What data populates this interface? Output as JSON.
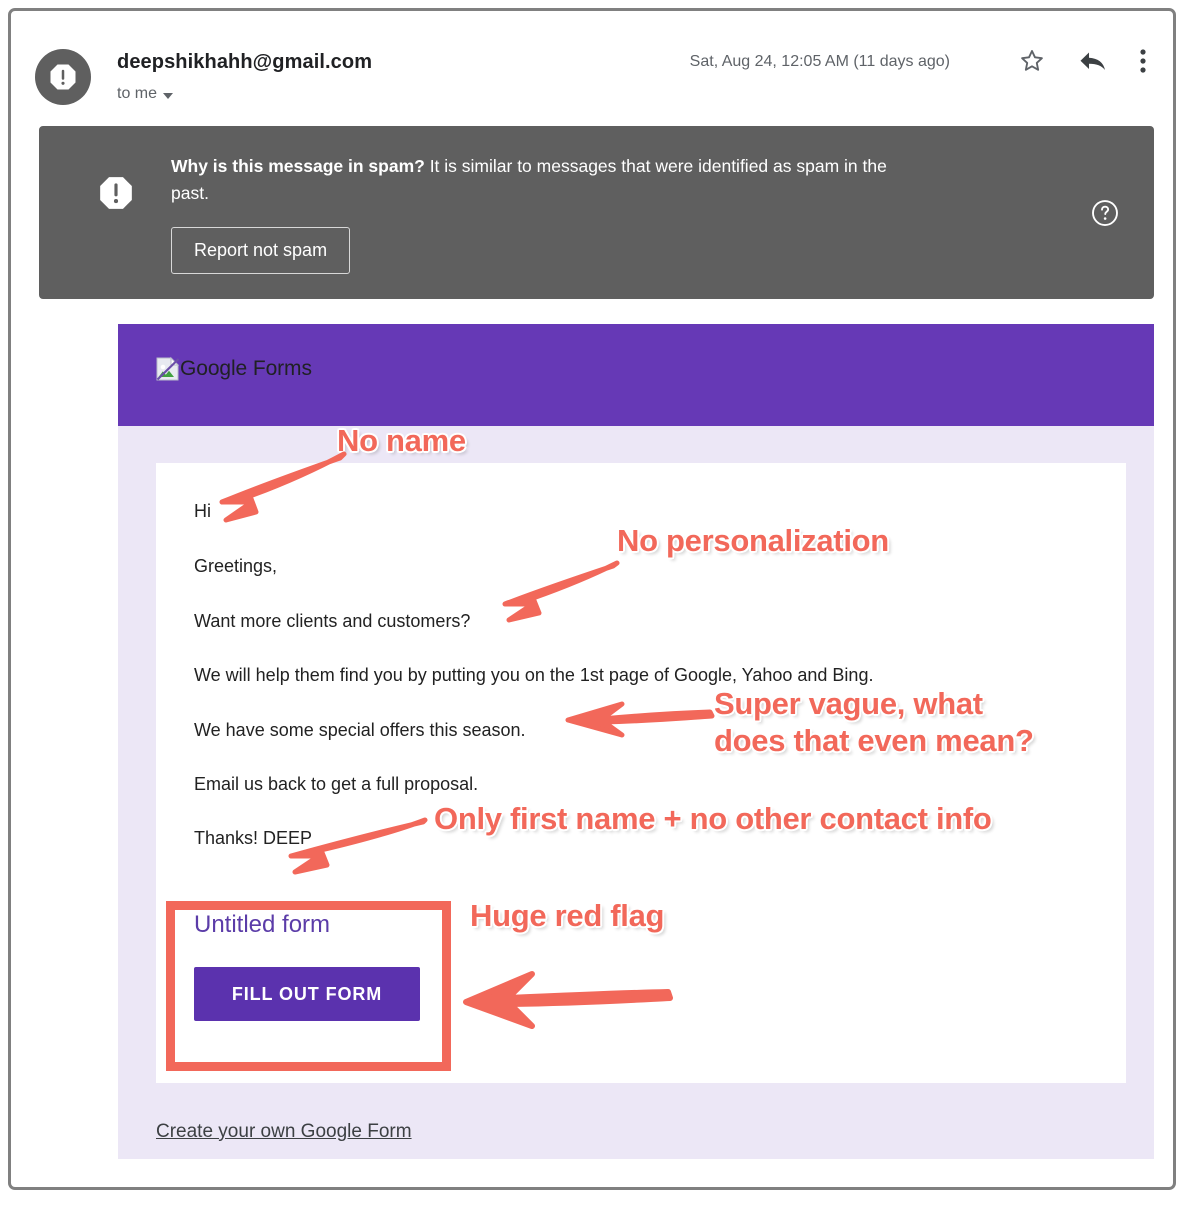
{
  "header": {
    "sender_email": "deepshikhahh@gmail.com",
    "recipient_label": "to me",
    "date": "Sat, Aug 24, 12:05 AM (11 days ago)",
    "avatar_icon": "spam-octagon-icon",
    "star_icon": "star-outline-icon",
    "reply_icon": "reply-arrow-icon",
    "more_icon": "kebab-menu-icon",
    "caret_icon": "chevron-down-icon"
  },
  "spam_banner": {
    "icon": "spam-octagon-icon",
    "question": "Why is this message in spam?",
    "explanation": " It is similar to messages that were identified as spam in the past.",
    "report_button": "Report not spam",
    "help_icon": "help-circle-icon",
    "background": "#5f5f5f"
  },
  "email": {
    "hero": {
      "background": "#6639b6",
      "image_alt": "Google Forms",
      "image_icon": "broken-image-icon"
    },
    "body_lines": [
      "Hi",
      "Greetings,",
      "Want more clients and customers?",
      "We will help them find you by putting you on the 1st page of Google, Yahoo and Bing.",
      "We have some special offers this season.",
      "Email us back to get a full proposal."
    ],
    "signature": "Thanks!\nDEEP",
    "form_card": {
      "title": "Untitled form",
      "button_label": "FILL OUT FORM",
      "button_color": "#5b32ae",
      "title_color": "#5b3ca8"
    },
    "footer_link": "Create your own Google Form",
    "background": "#ece7f6"
  },
  "annotations": {
    "color": "#f2685a",
    "items": [
      {
        "text": "No name"
      },
      {
        "text": "No personalization"
      },
      {
        "text": "Super vague, what\ndoes that even mean?"
      },
      {
        "text": "Only first name + no other contact info"
      },
      {
        "text": "Huge red flag"
      }
    ]
  }
}
